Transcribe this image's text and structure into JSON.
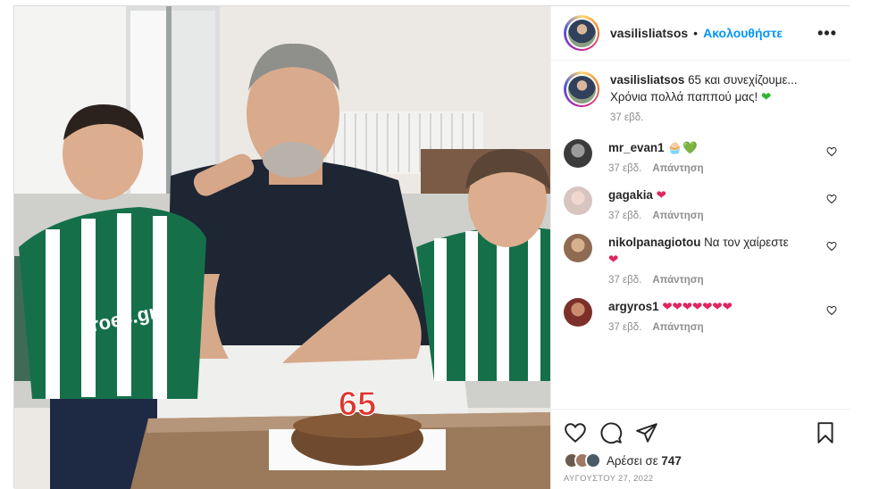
{
  "post": {
    "username": "vasilisliatsos",
    "follow_label": "Ακολουθήστε",
    "more_label": "•••",
    "caption_text_line1": "65 και συνεχίζουμε...",
    "caption_text_line2": "Χρόνια πολλά παππού μας!",
    "caption_time": "37 εβδ.",
    "photo_cake_number": "65",
    "photo_shirt_text": "iroes.gr",
    "likes_prefix": "Αρέσει σε",
    "likes_count": "747",
    "date": "ΑΥΓΟΥΣΤΟΥ 27, 2022"
  },
  "comments": [
    {
      "user": "mr_evan1",
      "text": "",
      "emoji": "🧁💚",
      "time": "37 εβδ.",
      "reply": "Απάντηση"
    },
    {
      "user": "gagakia",
      "text": "",
      "emoji": "❤",
      "time": "37 εβδ.",
      "reply": "Απάντηση"
    },
    {
      "user": "nikolpanagiotou",
      "text": "Να τον χαίρεστε",
      "emoji": "❤",
      "time": "37 εβδ.",
      "reply": "Απάντηση"
    },
    {
      "user": "argyros1",
      "text": "",
      "emoji": "❤❤❤❤❤❤❤",
      "time": "37 εβδ.",
      "reply": "Απάντηση"
    }
  ],
  "colors": {
    "accent": "#0095f6",
    "text": "#262626",
    "muted": "#8e8e8e",
    "heart": "#e0245e",
    "green_heart": "#2eb82e"
  },
  "icons": [
    "more-icon",
    "heart-outline-icon",
    "comment-icon",
    "share-icon",
    "bookmark-icon",
    "green-heart-icon",
    "red-heart-icon"
  ]
}
